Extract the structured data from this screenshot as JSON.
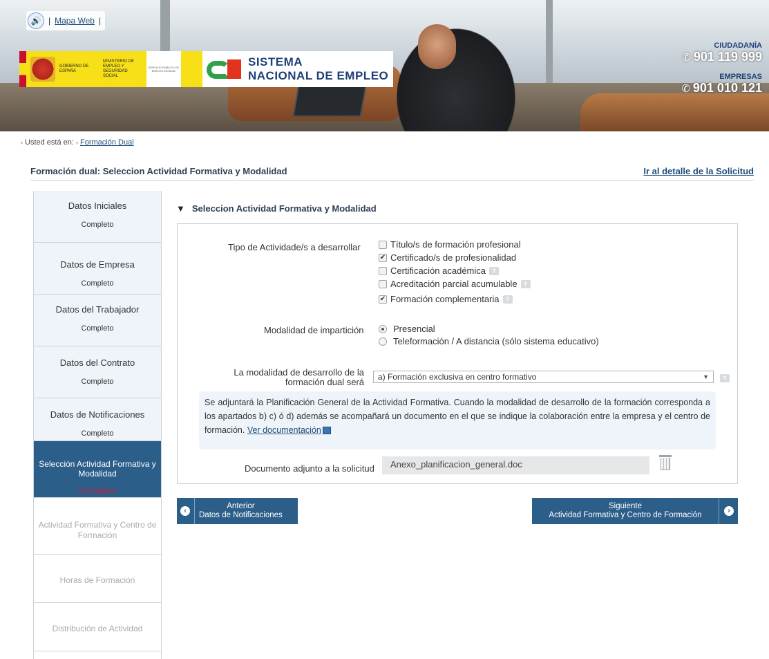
{
  "header": {
    "mapa_web": "Mapa Web",
    "gov_text": "GOBIERNO DE ESPAÑA",
    "ministry_text": "MINISTERIO DE EMPLEO Y SEGURIDAD SOCIAL",
    "sepe_text": "SERVICIO PÚBLICO DE EMPLEO ESTATAL",
    "sne_line1": "SISTEMA",
    "sne_line2": "NACIONAL DE EMPLEO",
    "ciudadania_label": "CIUDADANÍA",
    "ciudadania_phone": "901 119 999",
    "empresas_label": "EMPRESAS",
    "empresas_phone": "901 010 121"
  },
  "breadcrumb": {
    "prefix": "Usted está en:",
    "link": "Formación Dual"
  },
  "page": {
    "title": "Formación dual: Seleccion Actividad Formativa y Modalidad",
    "detail_link": "Ir al detalle de la Solicitud"
  },
  "steps": [
    {
      "name": "Datos Iniciales",
      "status": "Completo"
    },
    {
      "name": "Datos de Empresa",
      "status": "Completo"
    },
    {
      "name": "Datos del Trabajador",
      "status": "Completo"
    },
    {
      "name": "Datos del Contrato",
      "status": "Completo"
    },
    {
      "name": "Datos de Notificaciones",
      "status": "Completo"
    },
    {
      "name": "Selección Actividad Formativa y Modalidad",
      "status": "Incompleto"
    },
    {
      "name": "Actividad Formativa y Centro de Formación",
      "status": ""
    },
    {
      "name": "Horas de Formación",
      "status": ""
    },
    {
      "name": "Distribución de Actividad",
      "status": ""
    }
  ],
  "section": {
    "title": "Seleccion Actividad Formativa y Modalidad"
  },
  "form": {
    "tipo_label": "Tipo de Actividade/s a desarrollar",
    "tipo_options": [
      {
        "label": "Título/s de formación profesional",
        "checked": false,
        "help": false
      },
      {
        "label": "Certificado/s de profesionalidad",
        "checked": true,
        "help": false
      },
      {
        "label": "Certificación académica",
        "checked": false,
        "help": true
      },
      {
        "label": "Acreditación parcial acumulable",
        "checked": false,
        "help": true
      },
      {
        "label": "Formación complementaria",
        "checked": true,
        "help": true
      }
    ],
    "modalidad_label": "Modalidad de impartición",
    "modalidad_options": [
      {
        "label": "Presencial",
        "selected": true
      },
      {
        "label": "Teleformación / A distancia (sólo sistema educativo)",
        "selected": false
      }
    ],
    "desarrollo_label_1": "La modalidad de desarrollo de la",
    "desarrollo_label_2": "formación dual será",
    "desarrollo_value": "a) Formación exclusiva en centro formativo",
    "info_text": "Se adjuntará la Planificación General de la Actividad Formativa. Cuando la modalidad de desarrollo de la formación corresponda a los apartados b) c) ó d) además se acompañará un documento en el que se indique la colaboración entre la empresa y el centro de formación.",
    "info_link": "Ver documentación",
    "doc_label": "Documento adjunto a la solicitud",
    "doc_value": "Anexo_planificacion_general.doc",
    "help_glyph": "?"
  },
  "buttons": {
    "prev_line1": "Anterior",
    "prev_line2": "Datos de Notificaciones",
    "next_line1": "Siguiente",
    "next_line2": "Actividad Formativa y Centro de Formación",
    "prev_icon": "‹",
    "next_icon": "›"
  },
  "colors": {
    "primary": "#2c5e8a",
    "step_bg": "#eef4f9",
    "incomplete": "#d01f3c"
  }
}
